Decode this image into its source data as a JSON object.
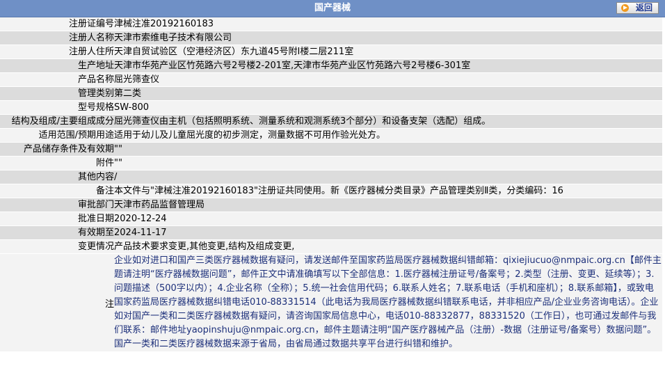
{
  "header": {
    "title": "国产器械",
    "back_label": "返回"
  },
  "rows": [
    {
      "label": "注册证编号",
      "value": "津械注准20192160183"
    },
    {
      "label": "注册人名称",
      "value": "天津市索维电子技术有限公司"
    },
    {
      "label": "注册人住所",
      "value": "天津自贸试验区（空港经济区）东九道45号附Ⅰ楼二层211室"
    },
    {
      "label": "生产地址",
      "value": "天津市华苑产业区竹苑路六号2号楼2-201室,天津市华苑产业区竹苑路六号2号楼6-301室"
    },
    {
      "label": "产品名称",
      "value": "屈光筛查仪"
    },
    {
      "label": "管理类别",
      "value": "第二类"
    },
    {
      "label": "型号规格",
      "value": "SW-800"
    },
    {
      "label": "结构及组成/主要组成成分",
      "value": "屈光筛查仪由主机（包括照明系统、测量系统和观测系统3个部分）和设备支架（选配）组成。"
    },
    {
      "label": "适用范围/预期用途",
      "value": "适用于幼儿及儿童屈光度的初步测定，测量数据不可用作验光处方。"
    },
    {
      "label": "产品储存条件及有效期",
      "value": "\"\""
    },
    {
      "label": "附件",
      "value": "\"\""
    },
    {
      "label": "其他内容",
      "value": "/"
    },
    {
      "label": "备注",
      "value": "本文件与\"津械注准20192160183\"注册证共同使用。新《医疗器械分类目录》产品管理类别Ⅱ类，分类编码：16"
    },
    {
      "label": "审批部门",
      "value": "天津市药品监督管理局"
    },
    {
      "label": "批准日期",
      "value": "2020-12-24"
    },
    {
      "label": "有效期至",
      "value": "2024-11-17"
    },
    {
      "label": "变更情况",
      "value": "产品技术要求变更,其他变更,结构及组成变更,"
    }
  ],
  "note": {
    "label": "注",
    "text": "企业如对进口和国产三类医疗器械数据有疑问，请发送邮件至国家药监局医疗器械数据纠错邮箱：qixiejiucuo@nmpaic.org.cn【邮件主题请注明“医疗器械数据问题”，邮件正文中请准确填写以下全部信息：1.医疗器械注册证号/备案号；2.类型（注册、变更、延续等）；3.问题描述（500字以内）；4.企业名称（全称）；5.统一社会信用代码；6.联系人姓名；7.联系电话（手机和座机）；8.联系邮箱】，或致电国家药监局医疗器械数据纠错电话010-88331514（此电话为我局医疗器械数据纠错联系电话，并非相应产品/企业业务咨询电话）。企业如对国产一类和二类医疗器械数据有疑问，请咨询国家局信息中心，电话010-88332877，88331520（工作日），也可通过发邮件与我们联系：邮件地址yaopinshuju@nmpaic.org.cn，邮件主题请注明“国产医疗器械产品（注册）-数据（注册证号/备案号）数据问题”。国产一类和二类医疗器械数据来源于省局，由省局通过数据共享平台进行纠错和维护。"
  }
}
